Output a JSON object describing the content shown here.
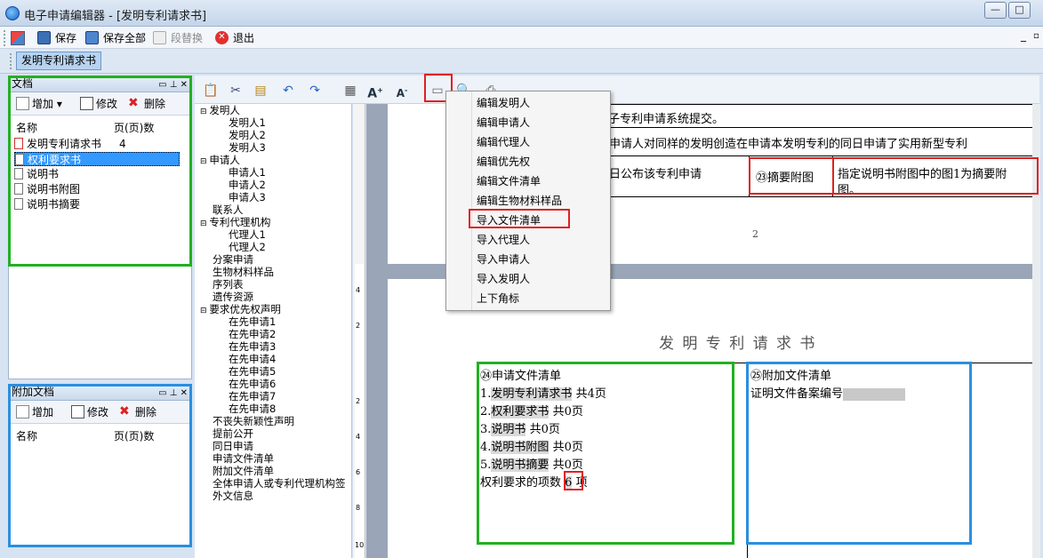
{
  "window": {
    "title": "电子申请编辑器 - [发明专利请求书]",
    "min": "—",
    "max": "□",
    "close": "✕"
  },
  "menubar": {
    "save": "保存",
    "save_all": "保存全部",
    "replace": "段替换",
    "exit": "退出"
  },
  "doc_tab": "发明专利请求书",
  "doc_panel": {
    "title": "文档",
    "add": "增加",
    "edit": "修改",
    "delete": "删除",
    "col_name": "名称",
    "col_pages": "页(页)数",
    "items": [
      {
        "name": "发明专利请求书",
        "pages": "4页"
      },
      {
        "name": "权利要求书",
        "pages": ""
      },
      {
        "name": "说明书",
        "pages": ""
      },
      {
        "name": "说明书附图",
        "pages": ""
      },
      {
        "name": "说明书摘要",
        "pages": ""
      }
    ]
  },
  "attach_panel": {
    "title": "附加文档",
    "add": "增加",
    "edit": "修改",
    "delete": "删除",
    "col_name": "名称",
    "col_pages": "页(页)数"
  },
  "tree": [
    "发明人",
    "发明人1",
    "发明人2",
    "发明人3",
    "申请人",
    "申请人1",
    "申请人2",
    "申请人3",
    "联系人",
    "专利代理机构",
    "代理人1",
    "代理人2",
    "分案申请",
    "生物材料样品",
    "序列表",
    "遗传资源",
    "要求优先权声明",
    "在先申请1",
    "在先申请2",
    "在先申请3",
    "在先申请4",
    "在先申请5",
    "在先申请6",
    "在先申请7",
    "在先申请8",
    "不丧失新颖性声明",
    "提前公开",
    "同日申请",
    "申请文件清单",
    "附加文件清单",
    "全体申请人或专利代理机构签",
    "外文信息"
  ],
  "context_menu": [
    "编辑发明人",
    "编辑申请人",
    "编辑代理人",
    "编辑优先权",
    "编辑文件清单",
    "编辑生物材料样品",
    "导入文件清单",
    "导入代理人",
    "导入申请人",
    "导入发明人",
    "上下角标"
  ],
  "page1": {
    "line1": "子专利申请系统提交。",
    "line2": "本申请人对同样的发明创造在申请本发明专利的同日申请了实用新型专利",
    "line3": "早日公布该专利申请",
    "abstract_label": "摘要附图",
    "abstract_num": "㉓",
    "abstract_text1": "指定说明书附图中的图1为摘要附",
    "abstract_text2": "图。",
    "page_number": "2"
  },
  "page2": {
    "title": "发 明 专 利 请 求 书",
    "list_title": "㉔申请文件清单",
    "files": [
      {
        "idx": "1.",
        "name": "发明专利请求书",
        "count": "共4页"
      },
      {
        "idx": "2.",
        "name": "权利要求书",
        "count": "共0页"
      },
      {
        "idx": "3.",
        "name": "说明书",
        "count": "共0页"
      },
      {
        "idx": "4.",
        "name": "说明书附图",
        "count": "共0页"
      },
      {
        "idx": "5.",
        "name": "说明书摘要",
        "count": "共0页"
      }
    ],
    "claims_label": "权利要求的项数",
    "claims_value": "6",
    "claims_unit": "项",
    "attach_title": "㉕附加文件清单",
    "attach_line": "证明文件备案编号"
  },
  "ruler": [
    "4",
    "2",
    "2",
    "4",
    "6",
    "8",
    "10"
  ]
}
